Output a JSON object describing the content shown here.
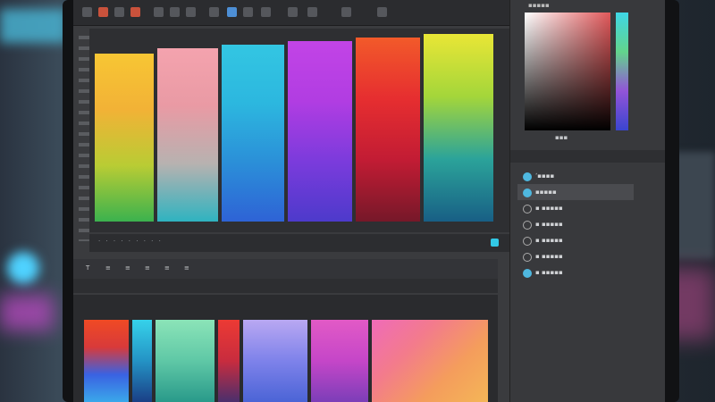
{
  "app": {
    "status_text": "· · · · · · · · ·",
    "toolbar2_items": [
      "T",
      "≡",
      "≡",
      "≡",
      "≡",
      "≡"
    ]
  },
  "canvas": {
    "swatches": [
      {
        "name": "yellow-green",
        "colors": [
          "#f7c634",
          "#f2b236",
          "#b9cc34",
          "#3bb24e"
        ]
      },
      {
        "name": "pink-teal",
        "colors": [
          "#f4a3ae",
          "#e99aa4",
          "#b7b2b0",
          "#2fb3c0"
        ]
      },
      {
        "name": "cyan-blue",
        "colors": [
          "#33c6e2",
          "#2cb7df",
          "#2b8fd8",
          "#2e63d6"
        ]
      },
      {
        "name": "magenta-violet",
        "colors": [
          "#c244e6",
          "#b13de2",
          "#7b3bdc",
          "#4d3acb"
        ]
      },
      {
        "name": "orange-crimson",
        "colors": [
          "#f25a2a",
          "#e62e30",
          "#c21c34",
          "#761829"
        ]
      },
      {
        "name": "lime-teal",
        "colors": [
          "#e9e636",
          "#a4d63a",
          "#2ba39a",
          "#185f85"
        ]
      }
    ]
  },
  "bottom_panel": {
    "swatches": [
      {
        "colors": [
          "#f04a24",
          "#d83a3a",
          "#3a62e2",
          "#3aa8ea"
        ]
      },
      {
        "colors": [
          "#36d2ea",
          "#2493c5",
          "#1a3f86"
        ]
      },
      {
        "colors": [
          "#8be4b8",
          "#5fc8a6",
          "#299a8a"
        ]
      },
      {
        "colors": [
          "#ec3a34",
          "#c82c3e",
          "#4a2f6c"
        ]
      },
      {
        "colors": [
          "#b9a8f2",
          "#7e82ea",
          "#4b64d6"
        ]
      },
      {
        "colors": [
          "#e25ac6",
          "#c546c8",
          "#7c3eb8"
        ]
      },
      {
        "colors": [
          "#ef6bb9",
          "#f37b8c",
          "#f49d5c",
          "#f4b657"
        ]
      }
    ]
  },
  "right_panel": {
    "picker_label": "▪▪▪",
    "tab_label": "▪▪▪▪▪",
    "layers": [
      {
        "label": "ʼ▪▪▪▪",
        "icon": "blue"
      },
      {
        "label": "▪▪▪▪▪",
        "icon": "blue",
        "selected": true
      },
      {
        "label": "▪ ▪▪▪▪▪",
        "icon": "ring"
      },
      {
        "label": "▪ ▪▪▪▪▪",
        "icon": "ring"
      },
      {
        "label": "▪ ▪▪▪▪▪",
        "icon": "ring"
      },
      {
        "label": "▪ ▪▪▪▪▪",
        "icon": "ring"
      },
      {
        "label": "▪ ▪▪▪▪▪",
        "icon": "blue"
      }
    ]
  }
}
